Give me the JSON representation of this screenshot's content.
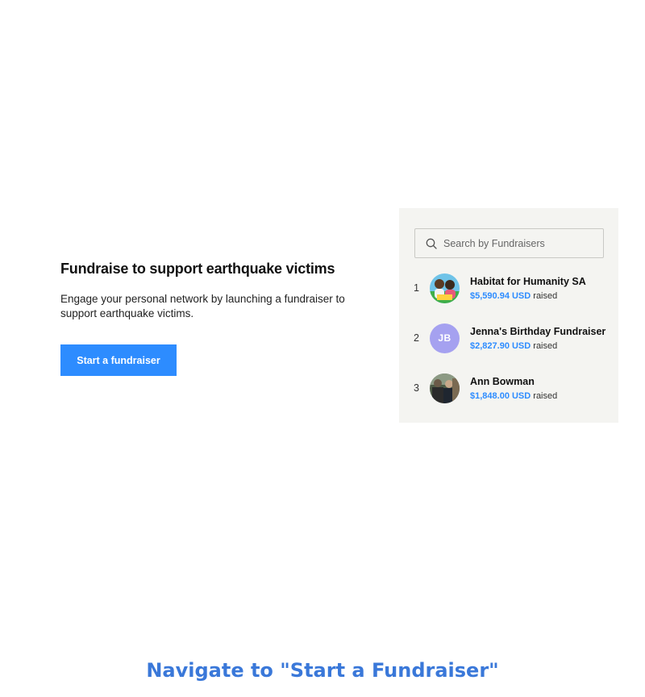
{
  "hero": {
    "title": "Fundraise to support earthquake victims",
    "description": "Engage your personal network by launching a fundraiser to support earthquake victims.",
    "cta_label": "Start a fundraiser"
  },
  "leaderboard": {
    "search_placeholder": "Search by Fundraisers",
    "search_icon": "search-icon",
    "items": [
      {
        "rank": "1",
        "name": "Habitat for Humanity SA",
        "amount": "$5,590.94 USD",
        "suffix": "raised",
        "avatar": "photo"
      },
      {
        "rank": "2",
        "name": "Jenna's Birthday Fundraiser",
        "amount": "$2,827.90 USD",
        "suffix": "raised",
        "avatar": "initials",
        "initials": "JB"
      },
      {
        "rank": "3",
        "name": "Ann Bowman",
        "amount": "$1,848.00 USD",
        "suffix": "raised",
        "avatar": "photo"
      }
    ]
  },
  "caption": "Navigate to \"Start a Fundraiser\"",
  "colors": {
    "accent": "#2d8cff",
    "panel_bg": "#f4f4f1",
    "avatar_initials_bg": "#a5a1f0",
    "caption": "#3a78d9"
  }
}
